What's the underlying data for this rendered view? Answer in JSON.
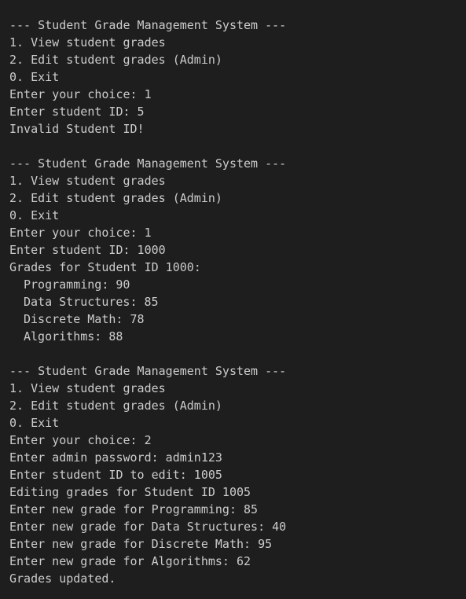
{
  "session1": {
    "header": "--- Student Grade Management System ---",
    "menu": [
      "1. View student grades",
      "2. Edit student grades (Admin)",
      "0. Exit"
    ],
    "choice": "Enter your choice: 1",
    "student_id": "Enter student ID: 5",
    "error": "Invalid Student ID!"
  },
  "session2": {
    "header": "--- Student Grade Management System ---",
    "menu": [
      "1. View student grades",
      "2. Edit student grades (Admin)",
      "0. Exit"
    ],
    "choice": "Enter your choice: 1",
    "student_id": "Enter student ID: 1000",
    "grades_title": "Grades for Student ID 1000:",
    "grades": [
      "Programming: 90",
      "Data Structures: 85",
      "Discrete Math: 78",
      "Algorithms: 88"
    ]
  },
  "session3": {
    "header": "--- Student Grade Management System ---",
    "menu": [
      "1. View student grades",
      "2. Edit student grades (Admin)",
      "0. Exit"
    ],
    "choice": "Enter your choice: 2",
    "password": "Enter admin password: admin123",
    "edit_id": "Enter student ID to edit: 1005",
    "editing": "Editing grades for Student ID 1005",
    "new_grades": [
      "Enter new grade for Programming: 85",
      "Enter new grade for Data Structures: 40",
      "Enter new grade for Discrete Math: 95",
      "Enter new grade for Algorithms: 62"
    ],
    "status": "Grades updated."
  }
}
